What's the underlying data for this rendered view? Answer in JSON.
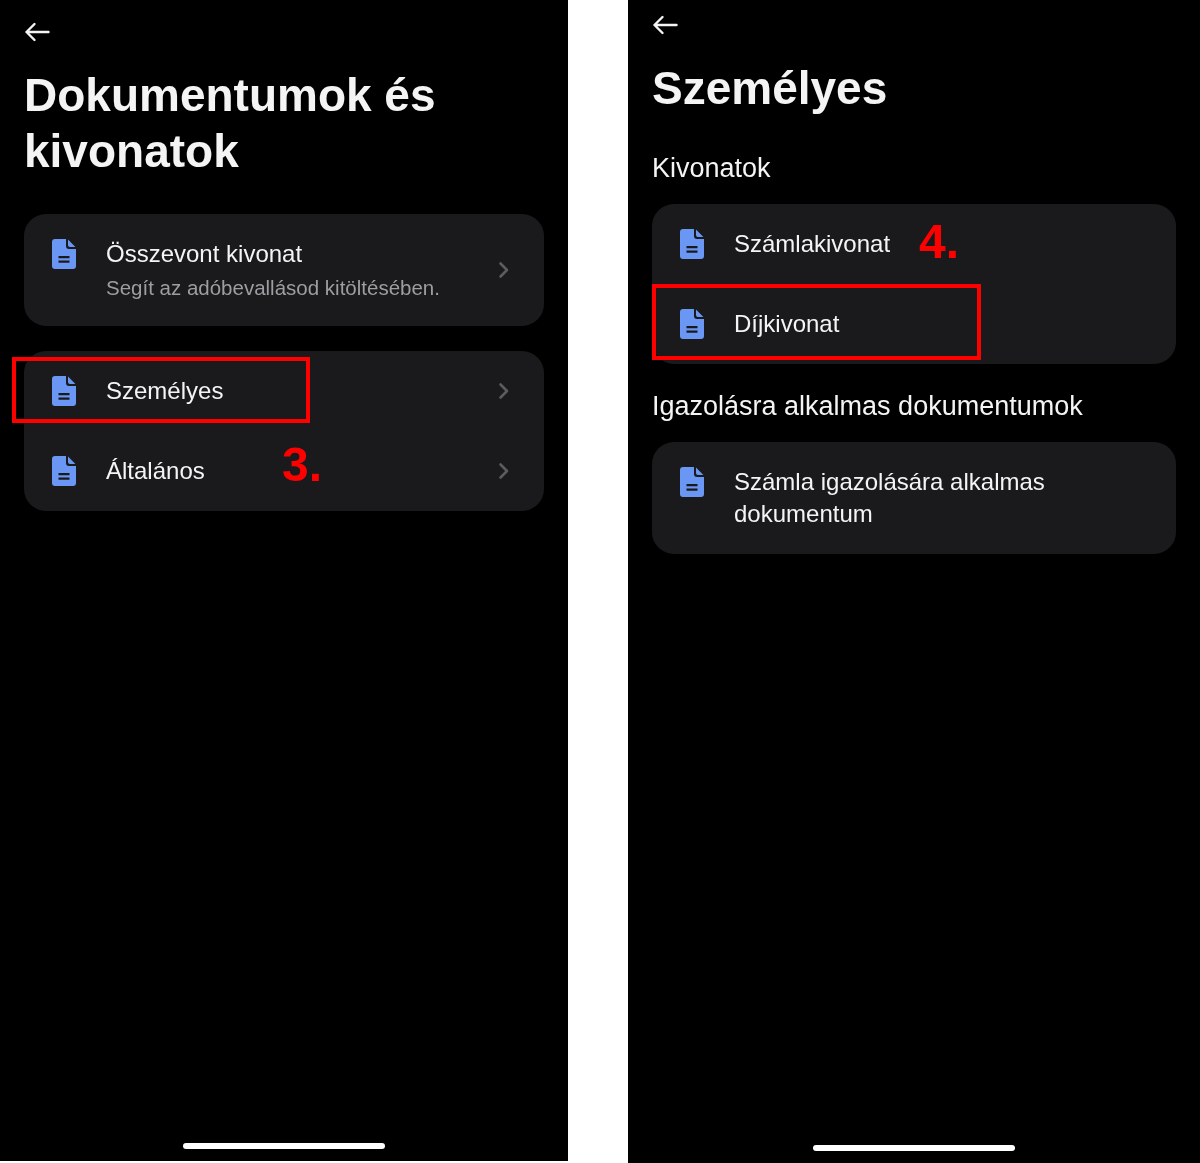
{
  "screens": [
    {
      "title": "Dokumentumok és kivonatok",
      "groups": [
        {
          "items": [
            {
              "title": "Összevont kivonat",
              "subtitle": "Segít az adóbevallásod kitöltésében.",
              "chevron": true,
              "highlighted": false
            }
          ]
        },
        {
          "items": [
            {
              "title": "Személyes",
              "chevron": true,
              "highlighted": true
            },
            {
              "title": "Általános",
              "chevron": true,
              "highlighted": false,
              "step": "3."
            }
          ]
        }
      ]
    },
    {
      "title": "Személyes",
      "groups": [
        {
          "heading": "Kivonatok",
          "items": [
            {
              "title": "Számlakivonat",
              "chevron": false,
              "highlighted": false,
              "step": "4."
            },
            {
              "title": "Díjkivonat",
              "chevron": false,
              "highlighted": true
            }
          ]
        },
        {
          "heading": "Igazolásra alkalmas dokumentumok",
          "items": [
            {
              "title": "Számla igazolására alkalmas dokumentum",
              "chevron": false,
              "highlighted": false
            }
          ]
        }
      ]
    }
  ]
}
